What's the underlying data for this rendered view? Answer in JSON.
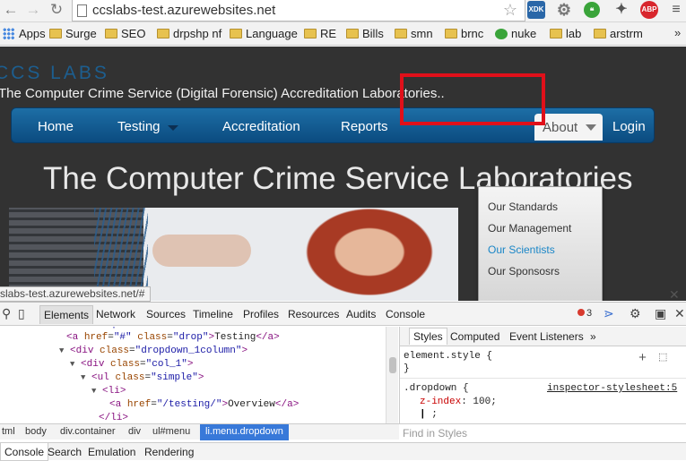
{
  "browser": {
    "url": "ccslabs-test.azurewebsites.net",
    "ext_xdk": "XDK",
    "ext_abp": "ABP"
  },
  "bookmarks": {
    "items": [
      "Apps",
      "Surge",
      "SEO",
      "drpshp nf",
      "Language",
      "RE",
      "Bills",
      "smn",
      "brnc",
      "nuke",
      "lab",
      "arstrm"
    ],
    "more": "»"
  },
  "site": {
    "title": "CCS LABS",
    "tagline": "The Computer Crime Service (Digital Forensic) Accreditation Laboratories..",
    "nav": {
      "home": "Home",
      "testing": "Testing",
      "accreditation": "Accreditation",
      "reports": "Reports",
      "about": "About",
      "login": "Login"
    },
    "about_menu": [
      "Our Standards",
      "Our Management",
      "Our Scientists",
      "Our Sponsosrs"
    ],
    "hero_title": "The Computer Crime Service Laboratories"
  },
  "status_bubble": "slabs-test.azurewebsites.net/#",
  "devtools": {
    "tabs": [
      "Elements",
      "Network",
      "Sources",
      "Timeline",
      "Profiles",
      "Resources",
      "Audits",
      "Console"
    ],
    "error_count": "3",
    "dom_lines": [
      {
        "indent": 0,
        "tri": "",
        "html": "<li class=\"menu dropdown\">"
      },
      {
        "indent": 74,
        "tri": "",
        "html": "<a href=\"#\" class=\"drop\">Testing</a>"
      },
      {
        "indent": 66,
        "tri": "▼",
        "html": "<div class=\"dropdown_1column\">"
      },
      {
        "indent": 78,
        "tri": "▼",
        "html": "<div class=\"col_1\">"
      },
      {
        "indent": 90,
        "tri": "▼",
        "html": "<ul class=\"simple\">"
      },
      {
        "indent": 102,
        "tri": "▼",
        "html": "<li>"
      },
      {
        "indent": 122,
        "tri": "",
        "html": "<a href=\"/testing/\">Overview</a>"
      },
      {
        "indent": 110,
        "tri": "",
        "html": "</li>"
      }
    ],
    "crumbs": [
      "tml",
      "body",
      "div.container",
      "div",
      "ul#menu",
      "li.menu.dropdown"
    ],
    "styles_tabs": [
      "Styles",
      "Computed",
      "Event Listeners",
      "»"
    ],
    "element_style": "element.style {",
    "element_style_close": "}",
    "rule_selector": ".dropdown {",
    "rule_prop": "z-index",
    "rule_value": "100;",
    "rule_source": "inspector-stylesheet:5",
    "rule_new": ";",
    "filter_placeholder": "Find in Styles",
    "drawer_tabs": [
      "Console",
      "Search",
      "Emulation",
      "Rendering"
    ]
  }
}
